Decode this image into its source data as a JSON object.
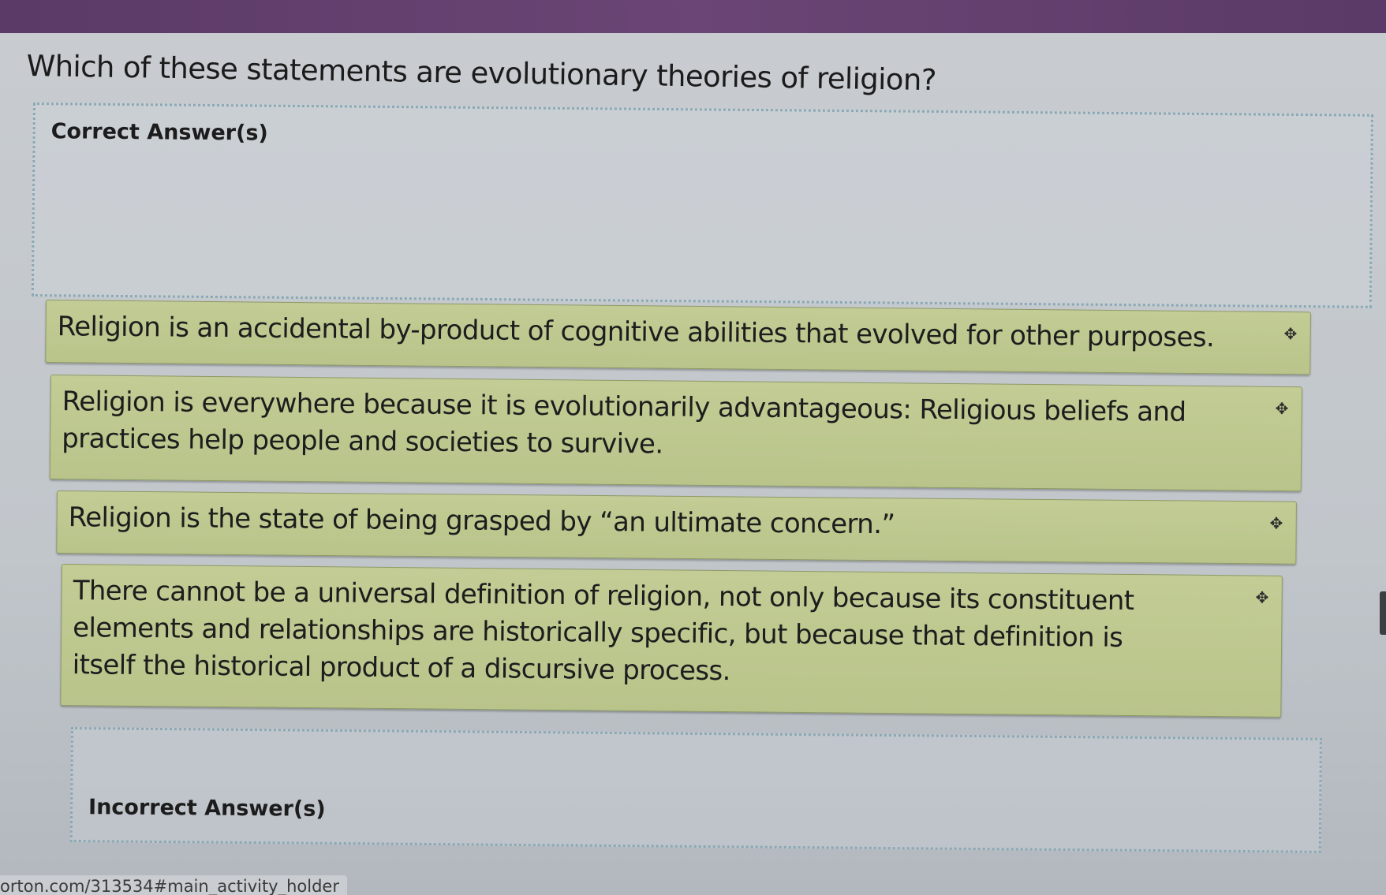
{
  "question": "Which of these statements are evolutionary theories of religion?",
  "correct_zone": {
    "label": "Correct Answer(s)"
  },
  "incorrect_zone": {
    "label": "Incorrect Answer(s)"
  },
  "answers": [
    {
      "text": "Religion is an accidental by-product of cognitive abilities that evolved for other purposes."
    },
    {
      "text": "Religion is everywhere because it is evolutionarily advantageous: Religious beliefs and practices help people and societies to survive."
    },
    {
      "text": "Religion is the state of being grasped by “an ultimate concern.”"
    },
    {
      "text": "There cannot be a universal definition of religion, not only because its constituent elements and relationships are historically specific, but because that definition is itself the historical product of a discursive process."
    }
  ],
  "move_icon_glyph": "✥",
  "status_url": "orton.com/313534#main_activity_holder"
}
